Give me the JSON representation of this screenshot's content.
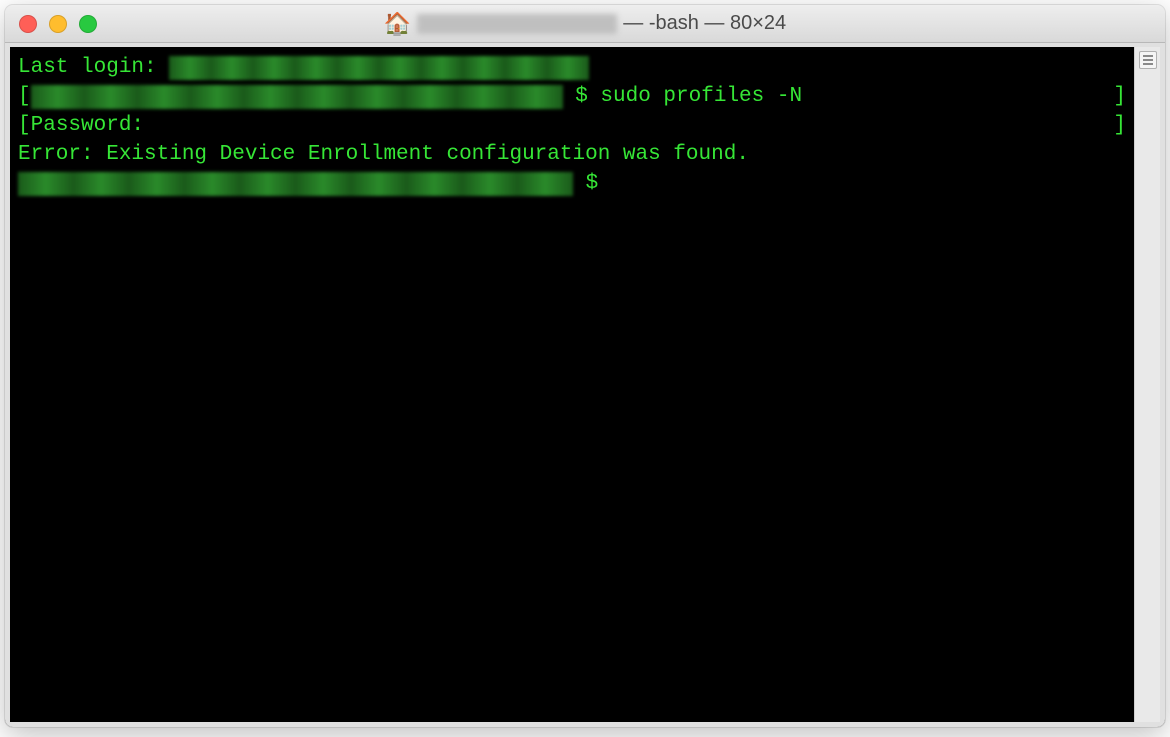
{
  "titlebar": {
    "title_suffix": " — -bash — 80×24"
  },
  "terminal": {
    "line1_prefix": "Last login: ",
    "line2_bracket_open": "[",
    "line2_prompt": " $ ",
    "line2_command": "sudo profiles -N",
    "line2_bracket_close": "]",
    "line3_bracket_open": "[",
    "line3_text": "Password:",
    "line3_bracket_close": "]",
    "line4_text": "Error: Existing Device Enrollment configuration was found.",
    "line5_prompt": " $ "
  },
  "colors": {
    "terminal_bg": "#000000",
    "terminal_fg": "#36e636"
  }
}
